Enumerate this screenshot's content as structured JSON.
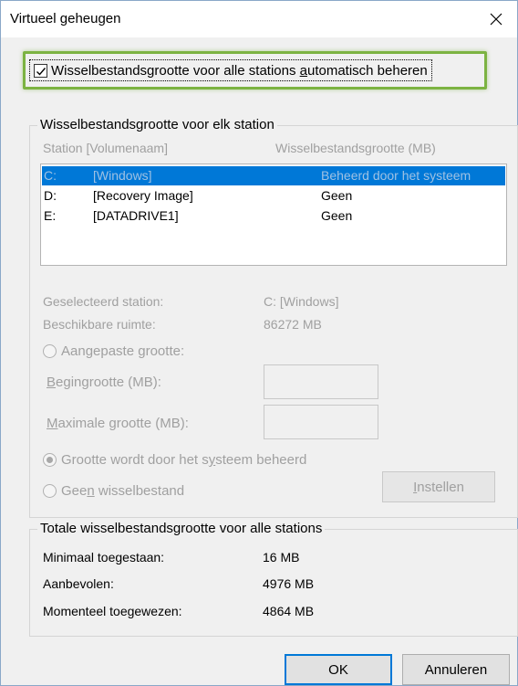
{
  "window": {
    "title": "Virtueel geheugen"
  },
  "auto_manage": {
    "checked": true,
    "label_pre": "Wisselbestandsgrootte voor alle stations ",
    "label_ul": "a",
    "label_post": "utomatisch beheren"
  },
  "per_station": {
    "group_title": "Wisselbestandsgrootte voor elk station",
    "col_station": "Station [Volumenaam]",
    "col_size": "Wisselbestandsgrootte (MB)",
    "drives": [
      {
        "letter": "C:",
        "name": "[Windows]",
        "size": "Beheerd door het systeem",
        "selected": true
      },
      {
        "letter": "D:",
        "name": "[Recovery Image]",
        "size": "Geen",
        "selected": false
      },
      {
        "letter": "E:",
        "name": "[DATADRIVE1]",
        "size": "Geen",
        "selected": false
      }
    ],
    "selected_label": "Geselecteerd station:",
    "selected_value": "C:  [Windows]",
    "space_label": "Beschikbare ruimte:",
    "space_value": "86272 MB",
    "custom_pre": "Aangepaste ",
    "custom_ul": "g",
    "custom_post": "rootte:",
    "initial_ul": "B",
    "initial_post": "egingrootte (MB):",
    "max_ul": "M",
    "max_post": "aximale grootte (MB):",
    "system_pre": "Grootte wordt door het s",
    "system_ul": "y",
    "system_post": "steem beheerd",
    "none_pre": "Gee",
    "none_ul": "n",
    "none_post": " wisselbestand",
    "set_ul": "I",
    "set_post": "nstellen"
  },
  "totals": {
    "group_title": "Totale wisselbestandsgrootte voor alle stations",
    "min_label": "Minimaal toegestaan:",
    "min_value": "16 MB",
    "rec_label": "Aanbevolen:",
    "rec_value": "4976 MB",
    "cur_label": "Momenteel toegewezen:",
    "cur_value": "4864 MB"
  },
  "buttons": {
    "ok": "OK",
    "cancel": "Annuleren"
  },
  "colors": {
    "accent": "#0078d7",
    "highlight_border": "#7cb342"
  }
}
